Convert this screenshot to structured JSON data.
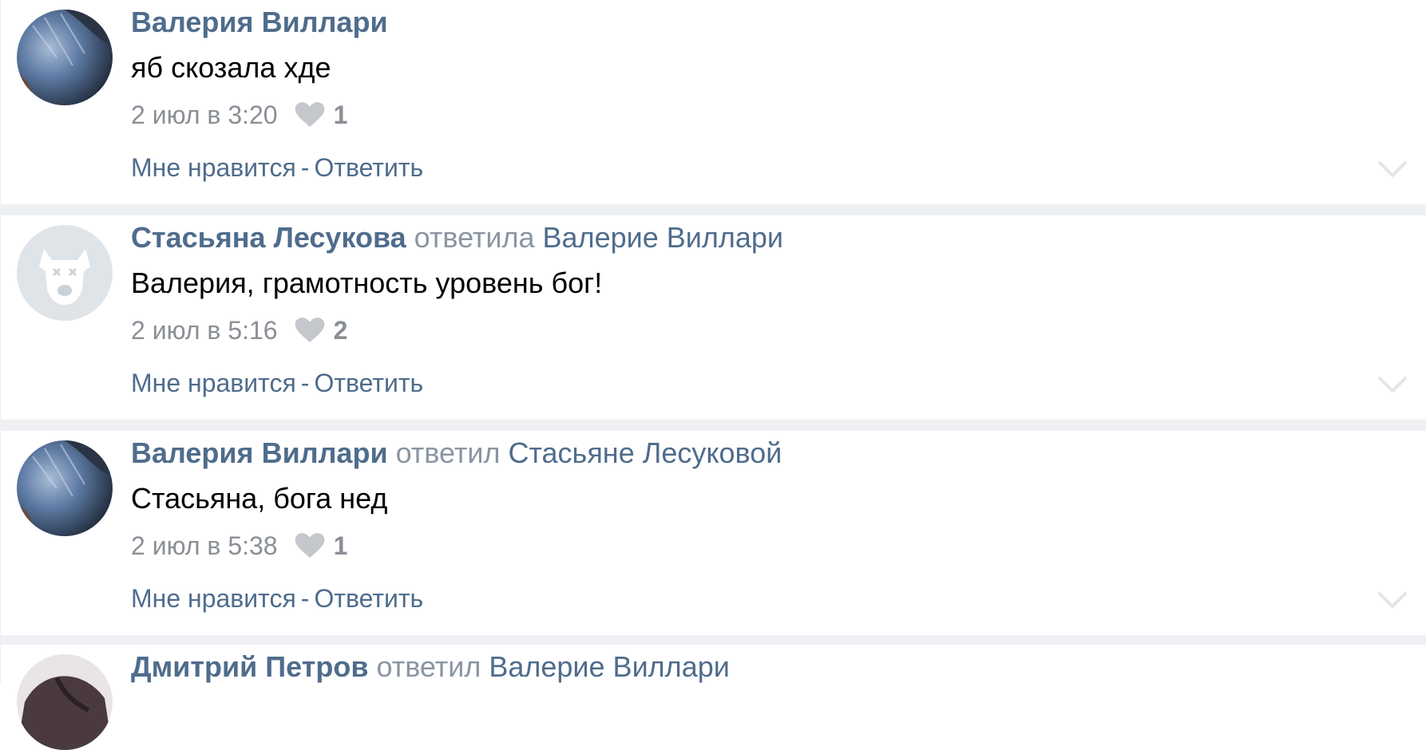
{
  "comments": [
    {
      "author": "Валерия Виллари",
      "verb": "",
      "reply_to": "",
      "text": "яб скозала хде",
      "time": "2 июл в 3:20",
      "likes": "1",
      "like_label": "Мне нравится",
      "separator": "-",
      "reply_label": "Ответить",
      "avatar": "photo-avatar"
    },
    {
      "author": "Стасьяна Лесукова",
      "verb": "ответила",
      "reply_to": "Валерие Виллари",
      "text": "Валерия, грамотность уровень бог!",
      "time": "2 июл в 5:16",
      "likes": "2",
      "like_label": "Мне нравится",
      "separator": "-",
      "reply_label": "Ответить",
      "avatar": "default-dog-avatar"
    },
    {
      "author": "Валерия Виллари",
      "verb": "ответил",
      "reply_to": "Стасьяне Лесуковой",
      "text": "Стасьяна, бога нед",
      "time": "2 июл в 5:38",
      "likes": "1",
      "like_label": "Мне нравится",
      "separator": "-",
      "reply_label": "Ответить",
      "avatar": "photo-avatar"
    },
    {
      "author": "Дмитрий Петров",
      "verb": "ответил",
      "reply_to": "Валерие Виллари",
      "avatar": "photo-avatar"
    }
  ],
  "colors": {
    "link": "#4f6c8c",
    "muted": "#8a95a3",
    "heart": "#c4c7cc",
    "divider": "#eef0f3"
  }
}
